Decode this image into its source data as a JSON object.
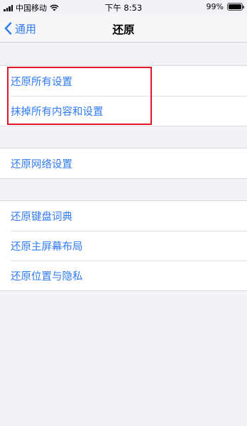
{
  "status_bar": {
    "carrier": "中国移动",
    "time": "下午 8:53",
    "battery_percent": "99%",
    "battery_level": 0.99
  },
  "nav": {
    "back_label": "通用",
    "title": "还原"
  },
  "groups": [
    {
      "items": [
        "还原所有设置",
        "抹掉所有内容和设置"
      ]
    },
    {
      "items": [
        "还原网络设置"
      ]
    },
    {
      "items": [
        "还原键盘词典",
        "还原主屏幕布局",
        "还原位置与隐私"
      ]
    }
  ],
  "colors": {
    "accent": "#2f7bf5",
    "highlight": "#e0182a",
    "background": "#f2f2f7"
  }
}
